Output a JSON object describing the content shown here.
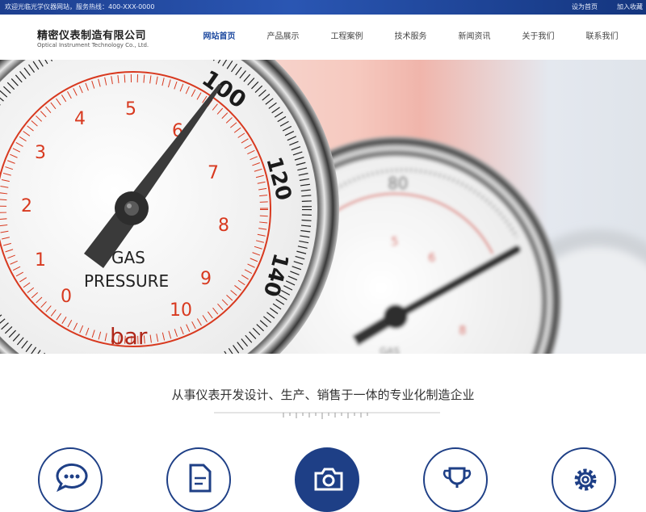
{
  "topbar": {
    "welcome": "欢迎光临光学仪器网站，服务热线：400-XXX-0000",
    "set_home": "设为首页",
    "add_favorite": "加入收藏"
  },
  "brand": {
    "name_cn": "精密仪表制造有限公司",
    "name_en": "Optical Instrument Technology Co., Ltd."
  },
  "nav": {
    "items": [
      {
        "label": "网站首页",
        "active": true
      },
      {
        "label": "产品展示"
      },
      {
        "label": "工程案例"
      },
      {
        "label": "技术服务"
      },
      {
        "label": "新闻资讯"
      },
      {
        "label": "关于我们"
      },
      {
        "label": "联系我们"
      }
    ]
  },
  "banner": {
    "gauge_main": {
      "scale_red": [
        "0",
        "1",
        "2",
        "3",
        "4",
        "5",
        "6",
        "7",
        "8",
        "9",
        "10"
      ],
      "scale_black": [
        "100",
        "120",
        "140"
      ],
      "label_line1": "GAS",
      "label_line2": "PRESSURE",
      "unit": "bar"
    },
    "gauge_back": {
      "scale_black": [
        "80"
      ],
      "scale_red": [
        "5",
        "6",
        "8"
      ],
      "label": "GAS"
    }
  },
  "intro": {
    "headline": "从事仪表开发设计、生产、销售于一体的专业化制造企业"
  },
  "features": [
    {
      "icon": "chat-bubble-icon"
    },
    {
      "icon": "document-icon"
    },
    {
      "icon": "camera-icon",
      "active": true
    },
    {
      "icon": "trophy-icon"
    },
    {
      "icon": "gear-icon"
    }
  ],
  "colors": {
    "brand_blue": "#1e3f86",
    "nav_active": "#1e4aa0",
    "gauge_red": "#d8391f"
  }
}
